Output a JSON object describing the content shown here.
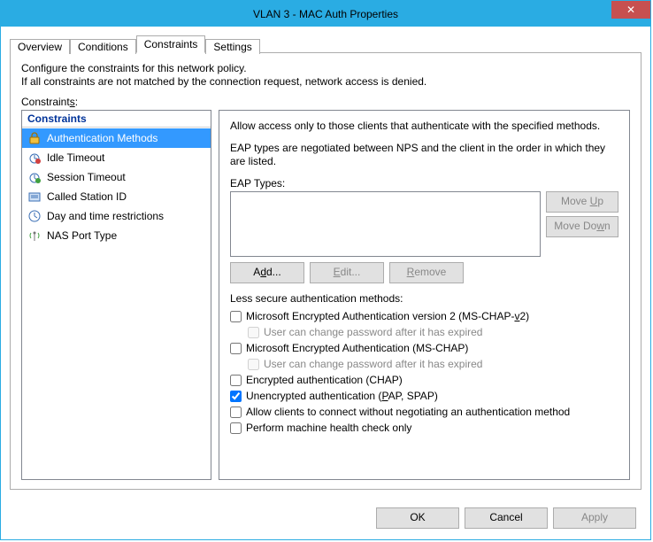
{
  "window": {
    "title": "VLAN 3 - MAC Auth Properties",
    "close_glyph": "✕"
  },
  "tabs": [
    "Overview",
    "Conditions",
    "Constraints",
    "Settings"
  ],
  "active_tab_index": 2,
  "description_line1": "Configure the constraints for this network policy.",
  "description_line2": "If all constraints are not matched by the connection request, network access is denied.",
  "constraints_label": "Constraints:",
  "left": {
    "header": "Constraints",
    "items": [
      {
        "label": "Authentication Methods",
        "icon": "lock-icon",
        "selected": true
      },
      {
        "label": "Idle Timeout",
        "icon": "timer-idle-icon",
        "selected": false
      },
      {
        "label": "Session Timeout",
        "icon": "timer-session-icon",
        "selected": false
      },
      {
        "label": "Called Station ID",
        "icon": "station-id-icon",
        "selected": false
      },
      {
        "label": "Day and time restrictions",
        "icon": "clock-icon",
        "selected": false
      },
      {
        "label": "NAS Port Type",
        "icon": "antenna-icon",
        "selected": false
      }
    ]
  },
  "right": {
    "intro": "Allow access only to those clients that authenticate with the specified methods.",
    "eap_intro": "EAP types are negotiated between NPS and the client in the order in which they are listed.",
    "eap_label": "EAP Types:",
    "buttons": {
      "move_up": "Move Up",
      "move_down": "Move Down",
      "add": "Add...",
      "edit": "Edit...",
      "remove": "Remove"
    },
    "less_secure_label": "Less secure authentication methods:",
    "checks": [
      {
        "label_html": "Microsoft Encrypted Authentication version 2 (MS-CHAP-<u>v</u>2)",
        "checked": false,
        "indent": false,
        "disabled": false
      },
      {
        "label_html": "User can change password after it has expired",
        "checked": false,
        "indent": true,
        "disabled": true
      },
      {
        "label_html": "Microsoft Encrypted Authentication (MS-CHAP)",
        "checked": false,
        "indent": false,
        "disabled": false
      },
      {
        "label_html": "User can change password after it has expired",
        "checked": false,
        "indent": true,
        "disabled": true
      },
      {
        "label_html": "Encrypted authentication (CHAP)",
        "checked": false,
        "indent": false,
        "disabled": false
      },
      {
        "label_html": "Unencrypted authentication (<u>P</u>AP, SPAP)",
        "checked": true,
        "indent": false,
        "disabled": false
      },
      {
        "label_html": "Allow clients to connect without negotiating an authentication method",
        "checked": false,
        "indent": false,
        "disabled": false
      },
      {
        "label_html": "Perform machine health check only",
        "checked": false,
        "indent": false,
        "disabled": false
      }
    ]
  },
  "dialog_buttons": {
    "ok": "OK",
    "cancel": "Cancel",
    "apply": "Apply"
  }
}
